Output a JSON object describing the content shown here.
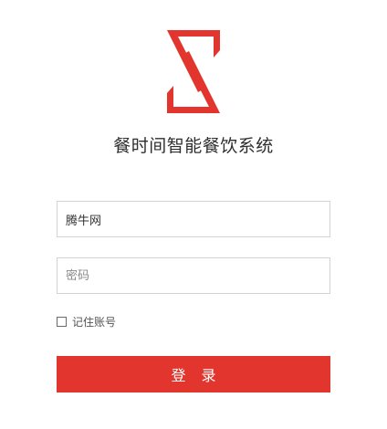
{
  "app": {
    "title": "餐时间智能餐饮系统",
    "brand_color": "#e1352d",
    "logo_icon": "hourglass-logo-icon"
  },
  "login_form": {
    "username": {
      "value": "腾牛网",
      "placeholder": ""
    },
    "password": {
      "value": "",
      "placeholder": "密码"
    },
    "remember": {
      "label": "记住账号",
      "checked": false
    },
    "submit_label": "登 录"
  }
}
